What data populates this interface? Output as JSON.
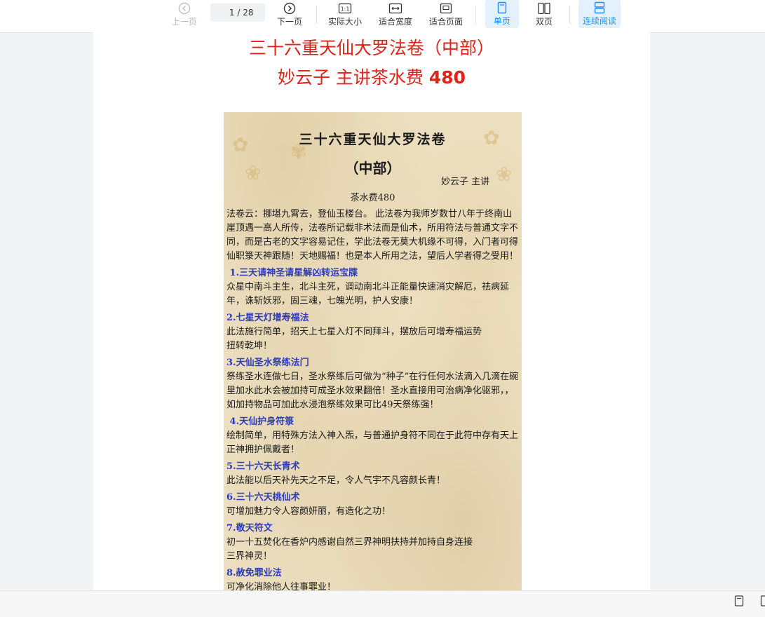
{
  "toolbar": {
    "prev_label": "上一页",
    "current_page": "1",
    "total_pages": "/ 28",
    "next_label": "下一页",
    "actual_size_label": "实际大小",
    "actual_size_icon_text": "1:1",
    "fit_width_label": "适合宽度",
    "fit_page_label": "适合页面",
    "single_page_label": "单页",
    "double_page_label": "双页",
    "continuous_label": "连续阅读",
    "active_color": "#1a8cff"
  },
  "document": {
    "title_line1": "三十六重天仙大罗法卷（中部）",
    "title_line2_text": "妙云子  主讲茶水费 ",
    "title_line2_price": "480",
    "title_color": "#e2231a",
    "scroll": {
      "title": "三十六重天仙大罗法卷",
      "subtitle": "（中部）",
      "author": "妙云子  主讲",
      "fee": "茶水费480",
      "intro": "法卷云：挪堪九霄去，登仙玉楼台。 此法卷为我师岁数廿八年于终南山崖顶遇一高人所传，法卷所记载非术法而是仙术，所用符法与普通文字不同，而是古老的文字容易记住，学此法卷无莫大机缘不可得，入门者可得仙职箓天神跟随！天地赐福！也是本人所用之法，望后人学者得之受用！",
      "heading_color": "#2d3bbd",
      "sections": [
        {
          "heading": " 1.三天请神圣请星解凶转运宝牒",
          "body": "众星中南斗主生，北斗主死，调动南北斗正能量快速消灾解厄，祛病延年，诛斩妖邪，固三魂，七魄光明，护人安康！"
        },
        {
          "heading": "2.七星天灯增寿福法",
          "body": "此法施行简单，招天上七星入灯不同拜斗，摆放后可增寿福运势\n扭转乾坤！"
        },
        {
          "heading": "3.天仙圣水祭练法门",
          "body": "祭练圣水连做七日，圣水祭练后可做为“种子”在行任何水法滴入几滴在碗里加水此水会被加持可成圣水效果翻倍！圣水直接用可治病净化驱邪，，如加持物品可加此水浸泡祭练效果可比49天祭练强！"
        },
        {
          "heading": " 4.天仙护身符箓",
          "body": "绘制简单，用特殊方法入神入炁，与普通护身符不同在于此符中存有天上正神拥护佩戴者！"
        },
        {
          "heading": "5.三十六天长青术",
          "body": "此法能以后天补先天之不足，令人气宇不凡容颜长青！"
        },
        {
          "heading": "6.三十六天桃仙术",
          "body": "可增加魅力令人容颜妍丽，有造化之功！"
        },
        {
          "heading": "7.敬天符文",
          "body": "初一十五焚化在香炉内感谢自然三界神明扶持并加持自身连接\n三界神灵！"
        },
        {
          "heading": "8.赦免罪业法",
          "body": "可净化消除他人往事罪业！"
        }
      ]
    }
  }
}
